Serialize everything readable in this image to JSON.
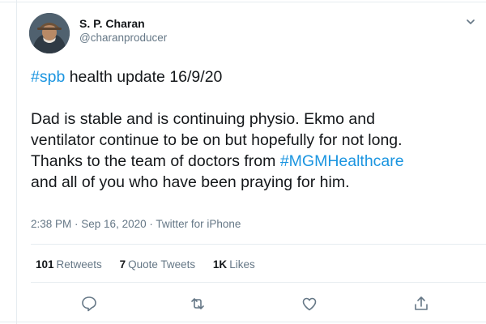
{
  "author": {
    "display_name": "S. P. Charan",
    "handle": "@charanproducer"
  },
  "tweet": {
    "line1_tag": "#spb",
    "line1_rest": " health update 16/9/20",
    "body_line1": "Dad is stable and is continuing physio. Ekmo and",
    "body_line2": "ventilator continue to be on but hopefully for not long.",
    "body_line3_pre": "Thanks to the team of doctors from ",
    "body_line3_tag": "#MGMHealthcare",
    "body_line4": "and all of you who have been praying for him."
  },
  "meta": {
    "time": "2:38 PM",
    "sep1": " · ",
    "date": "Sep 16, 2020",
    "sep2": " · ",
    "source": "Twitter for iPhone"
  },
  "stats": {
    "retweets_count": "101",
    "retweets_label": "Retweets",
    "quotes_count": "7",
    "quotes_label": "Quote Tweets",
    "likes_count": "1K",
    "likes_label": "Likes"
  },
  "icons": {
    "caret": "chevron-down-icon",
    "reply": "reply-icon",
    "retweet": "retweet-icon",
    "like": "heart-icon",
    "share": "share-icon"
  },
  "colors": {
    "link": "#1b95e0",
    "muted": "#657786",
    "text": "#14171a"
  }
}
